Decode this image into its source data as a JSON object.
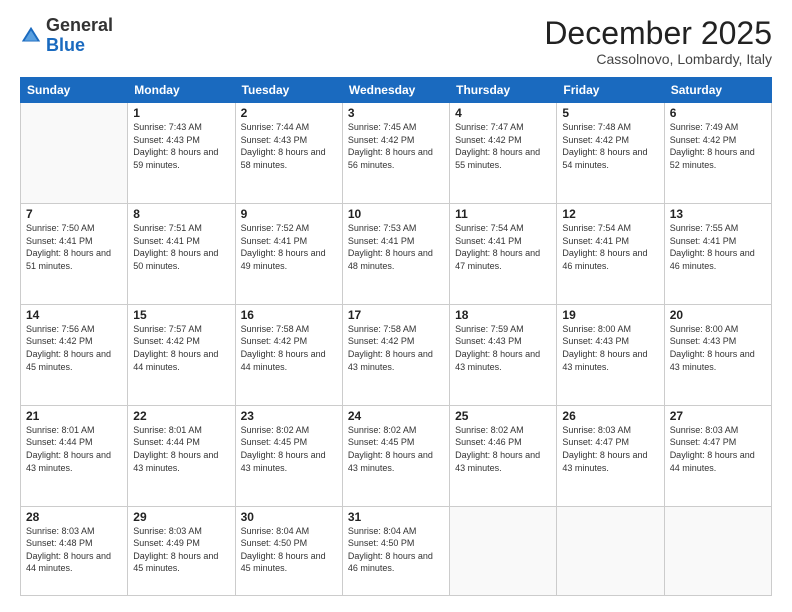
{
  "logo": {
    "general": "General",
    "blue": "Blue"
  },
  "header": {
    "month": "December 2025",
    "location": "Cassolnovo, Lombardy, Italy"
  },
  "weekdays": [
    "Sunday",
    "Monday",
    "Tuesday",
    "Wednesday",
    "Thursday",
    "Friday",
    "Saturday"
  ],
  "weeks": [
    [
      {
        "day": "",
        "sunrise": "",
        "sunset": "",
        "daylight": ""
      },
      {
        "day": "1",
        "sunrise": "Sunrise: 7:43 AM",
        "sunset": "Sunset: 4:43 PM",
        "daylight": "Daylight: 8 hours and 59 minutes."
      },
      {
        "day": "2",
        "sunrise": "Sunrise: 7:44 AM",
        "sunset": "Sunset: 4:43 PM",
        "daylight": "Daylight: 8 hours and 58 minutes."
      },
      {
        "day": "3",
        "sunrise": "Sunrise: 7:45 AM",
        "sunset": "Sunset: 4:42 PM",
        "daylight": "Daylight: 8 hours and 56 minutes."
      },
      {
        "day": "4",
        "sunrise": "Sunrise: 7:47 AM",
        "sunset": "Sunset: 4:42 PM",
        "daylight": "Daylight: 8 hours and 55 minutes."
      },
      {
        "day": "5",
        "sunrise": "Sunrise: 7:48 AM",
        "sunset": "Sunset: 4:42 PM",
        "daylight": "Daylight: 8 hours and 54 minutes."
      },
      {
        "day": "6",
        "sunrise": "Sunrise: 7:49 AM",
        "sunset": "Sunset: 4:42 PM",
        "daylight": "Daylight: 8 hours and 52 minutes."
      }
    ],
    [
      {
        "day": "7",
        "sunrise": "Sunrise: 7:50 AM",
        "sunset": "Sunset: 4:41 PM",
        "daylight": "Daylight: 8 hours and 51 minutes."
      },
      {
        "day": "8",
        "sunrise": "Sunrise: 7:51 AM",
        "sunset": "Sunset: 4:41 PM",
        "daylight": "Daylight: 8 hours and 50 minutes."
      },
      {
        "day": "9",
        "sunrise": "Sunrise: 7:52 AM",
        "sunset": "Sunset: 4:41 PM",
        "daylight": "Daylight: 8 hours and 49 minutes."
      },
      {
        "day": "10",
        "sunrise": "Sunrise: 7:53 AM",
        "sunset": "Sunset: 4:41 PM",
        "daylight": "Daylight: 8 hours and 48 minutes."
      },
      {
        "day": "11",
        "sunrise": "Sunrise: 7:54 AM",
        "sunset": "Sunset: 4:41 PM",
        "daylight": "Daylight: 8 hours and 47 minutes."
      },
      {
        "day": "12",
        "sunrise": "Sunrise: 7:54 AM",
        "sunset": "Sunset: 4:41 PM",
        "daylight": "Daylight: 8 hours and 46 minutes."
      },
      {
        "day": "13",
        "sunrise": "Sunrise: 7:55 AM",
        "sunset": "Sunset: 4:41 PM",
        "daylight": "Daylight: 8 hours and 46 minutes."
      }
    ],
    [
      {
        "day": "14",
        "sunrise": "Sunrise: 7:56 AM",
        "sunset": "Sunset: 4:42 PM",
        "daylight": "Daylight: 8 hours and 45 minutes."
      },
      {
        "day": "15",
        "sunrise": "Sunrise: 7:57 AM",
        "sunset": "Sunset: 4:42 PM",
        "daylight": "Daylight: 8 hours and 44 minutes."
      },
      {
        "day": "16",
        "sunrise": "Sunrise: 7:58 AM",
        "sunset": "Sunset: 4:42 PM",
        "daylight": "Daylight: 8 hours and 44 minutes."
      },
      {
        "day": "17",
        "sunrise": "Sunrise: 7:58 AM",
        "sunset": "Sunset: 4:42 PM",
        "daylight": "Daylight: 8 hours and 43 minutes."
      },
      {
        "day": "18",
        "sunrise": "Sunrise: 7:59 AM",
        "sunset": "Sunset: 4:43 PM",
        "daylight": "Daylight: 8 hours and 43 minutes."
      },
      {
        "day": "19",
        "sunrise": "Sunrise: 8:00 AM",
        "sunset": "Sunset: 4:43 PM",
        "daylight": "Daylight: 8 hours and 43 minutes."
      },
      {
        "day": "20",
        "sunrise": "Sunrise: 8:00 AM",
        "sunset": "Sunset: 4:43 PM",
        "daylight": "Daylight: 8 hours and 43 minutes."
      }
    ],
    [
      {
        "day": "21",
        "sunrise": "Sunrise: 8:01 AM",
        "sunset": "Sunset: 4:44 PM",
        "daylight": "Daylight: 8 hours and 43 minutes."
      },
      {
        "day": "22",
        "sunrise": "Sunrise: 8:01 AM",
        "sunset": "Sunset: 4:44 PM",
        "daylight": "Daylight: 8 hours and 43 minutes."
      },
      {
        "day": "23",
        "sunrise": "Sunrise: 8:02 AM",
        "sunset": "Sunset: 4:45 PM",
        "daylight": "Daylight: 8 hours and 43 minutes."
      },
      {
        "day": "24",
        "sunrise": "Sunrise: 8:02 AM",
        "sunset": "Sunset: 4:45 PM",
        "daylight": "Daylight: 8 hours and 43 minutes."
      },
      {
        "day": "25",
        "sunrise": "Sunrise: 8:02 AM",
        "sunset": "Sunset: 4:46 PM",
        "daylight": "Daylight: 8 hours and 43 minutes."
      },
      {
        "day": "26",
        "sunrise": "Sunrise: 8:03 AM",
        "sunset": "Sunset: 4:47 PM",
        "daylight": "Daylight: 8 hours and 43 minutes."
      },
      {
        "day": "27",
        "sunrise": "Sunrise: 8:03 AM",
        "sunset": "Sunset: 4:47 PM",
        "daylight": "Daylight: 8 hours and 44 minutes."
      }
    ],
    [
      {
        "day": "28",
        "sunrise": "Sunrise: 8:03 AM",
        "sunset": "Sunset: 4:48 PM",
        "daylight": "Daylight: 8 hours and 44 minutes."
      },
      {
        "day": "29",
        "sunrise": "Sunrise: 8:03 AM",
        "sunset": "Sunset: 4:49 PM",
        "daylight": "Daylight: 8 hours and 45 minutes."
      },
      {
        "day": "30",
        "sunrise": "Sunrise: 8:04 AM",
        "sunset": "Sunset: 4:50 PM",
        "daylight": "Daylight: 8 hours and 45 minutes."
      },
      {
        "day": "31",
        "sunrise": "Sunrise: 8:04 AM",
        "sunset": "Sunset: 4:50 PM",
        "daylight": "Daylight: 8 hours and 46 minutes."
      },
      {
        "day": "",
        "sunrise": "",
        "sunset": "",
        "daylight": ""
      },
      {
        "day": "",
        "sunrise": "",
        "sunset": "",
        "daylight": ""
      },
      {
        "day": "",
        "sunrise": "",
        "sunset": "",
        "daylight": ""
      }
    ]
  ]
}
